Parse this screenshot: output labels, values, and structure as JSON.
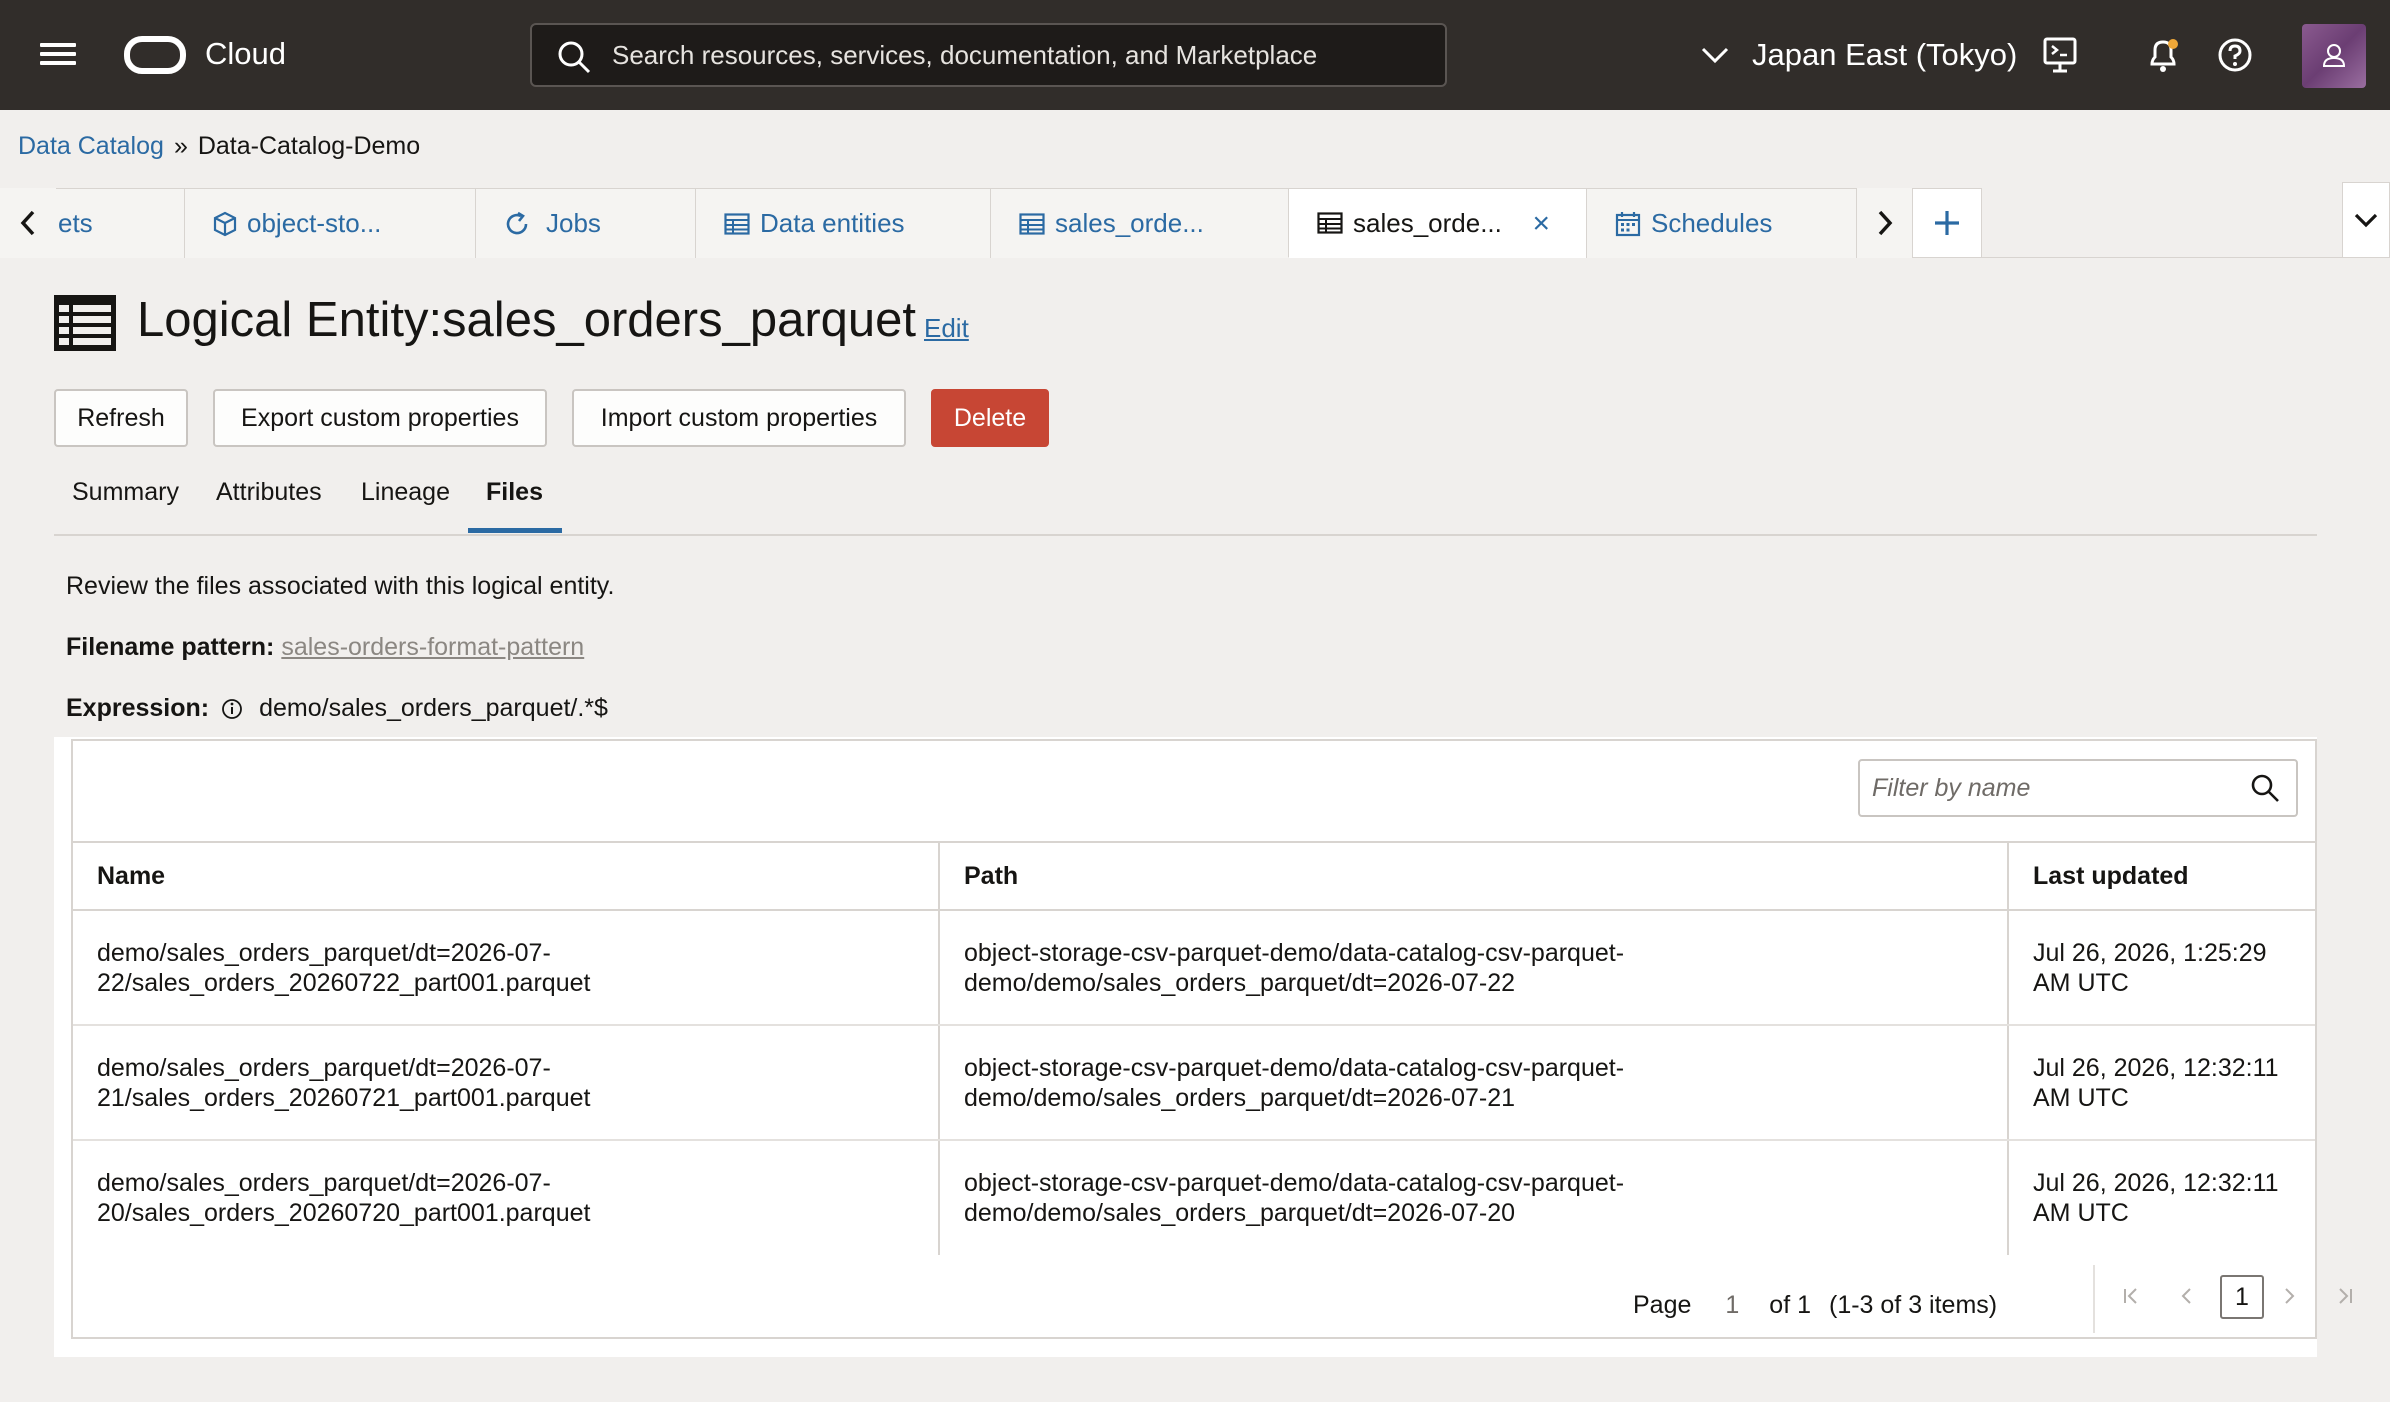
{
  "header": {
    "brand": "Cloud",
    "search_placeholder": "Search resources, services, documentation, and Marketplace",
    "region": "Japan East (Tokyo)"
  },
  "breadcrumb": {
    "root": "Data Catalog",
    "separator": "»",
    "current": "Data-Catalog-Demo"
  },
  "tabs": [
    {
      "label": "ets",
      "icon": "none"
    },
    {
      "label": "object-sto...",
      "icon": "cube-icon"
    },
    {
      "label": "Jobs",
      "icon": "refresh-icon"
    },
    {
      "label": "Data entities",
      "icon": "table-icon"
    },
    {
      "label": "sales_orde...",
      "icon": "table-icon"
    },
    {
      "label": "sales_orde...",
      "icon": "table-icon",
      "active": true,
      "close": "×"
    },
    {
      "label": "Schedules",
      "icon": "calendar-icon"
    }
  ],
  "page": {
    "title": "Logical Entity:sales_orders_parquet",
    "edit_label": "Edit",
    "buttons": {
      "refresh": "Refresh",
      "export": "Export custom properties",
      "import": "Import custom properties",
      "delete": "Delete"
    },
    "subtabs": [
      "Summary",
      "Attributes",
      "Lineage",
      "Files"
    ],
    "active_subtab": "Files",
    "description": "Review the files associated with this logical entity.",
    "filename_pattern_label": "Filename pattern:",
    "filename_pattern_value": "sales-orders-format-pattern",
    "expression_label": "Expression:",
    "expression_value": "demo/sales_orders_parquet/.*$"
  },
  "table": {
    "filter_placeholder": "Filter by name",
    "columns": [
      "Name",
      "Path",
      "Last updated"
    ],
    "rows": [
      {
        "name": "demo/sales_orders_parquet/dt=2026-07-\n22/sales_orders_20260722_part001.parquet",
        "path": "object-storage-csv-parquet-demo/data-catalog-csv-parquet-\ndemo/demo/sales_orders_parquet/dt=2026-07-22",
        "updated": "Jul 26, 2026, 1:25:29\nAM UTC"
      },
      {
        "name": "demo/sales_orders_parquet/dt=2026-07-\n21/sales_orders_20260721_part001.parquet",
        "path": "object-storage-csv-parquet-demo/data-catalog-csv-parquet-\ndemo/demo/sales_orders_parquet/dt=2026-07-21",
        "updated": "Jul 26, 2026, 12:32:11\nAM UTC"
      },
      {
        "name": "demo/sales_orders_parquet/dt=2026-07-\n20/sales_orders_20260720_part001.parquet",
        "path": "object-storage-csv-parquet-demo/data-catalog-csv-parquet-\ndemo/demo/sales_orders_parquet/dt=2026-07-20",
        "updated": "Jul 26, 2026, 12:32:11\nAM UTC"
      }
    ],
    "pagination": {
      "page_label": "Page",
      "page_input": "1",
      "of_label": "of 1",
      "items_label": "(1-3 of 3 items)",
      "current_page": "1"
    }
  },
  "colors": {
    "topbar": "#312d2a",
    "link": "#2b6aa3",
    "danger": "#c74634",
    "background": "#f1efed"
  }
}
